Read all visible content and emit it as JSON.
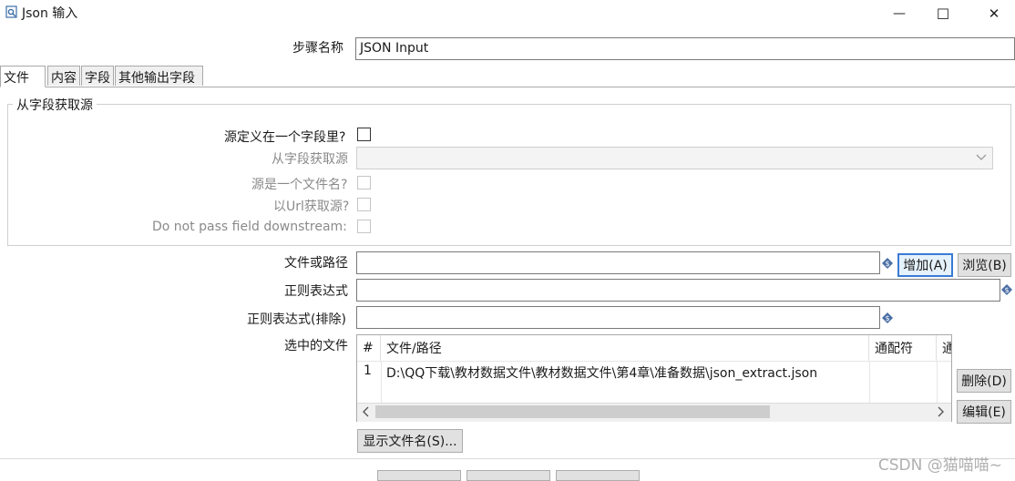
{
  "window": {
    "title": "Json 输入",
    "minimize_glyph": "—",
    "maximize_glyph": "☐",
    "close_glyph": "✕"
  },
  "step_name": {
    "label": "步骤名称",
    "value": "JSON Input"
  },
  "tabs": [
    {
      "label": "文件",
      "active": true
    },
    {
      "label": "内容",
      "active": false
    },
    {
      "label": "字段",
      "active": false
    },
    {
      "label": "其他输出字段",
      "active": false
    }
  ],
  "source_group": {
    "title": "从字段获取源",
    "source_in_field_label": "源定义在一个字段里?",
    "from_field_label": "从字段获取源",
    "from_field_value": "",
    "source_is_filename_label": "源是一个文件名?",
    "read_url_label": "以Url获取源?",
    "do_not_pass_label": "Do not pass field downstream:"
  },
  "file": {
    "path_label": "文件或路径",
    "path_value": "",
    "add_button": "增加(A)",
    "browse_button": "浏览(B)",
    "regex_label": "正则表达式",
    "regex_value": "",
    "regex_exclude_label": "正则表达式(排除)",
    "regex_exclude_value": ""
  },
  "selected_files": {
    "label": "选中的文件",
    "columns": [
      "#",
      "文件/路径",
      "通配符",
      "通"
    ],
    "rows": [
      {
        "num": "1",
        "path": "D:\\QQ下载\\教材数据文件\\教材数据文件\\第4章\\准备数据\\json_extract.json",
        "wildcard": ""
      }
    ],
    "delete_button": "删除(D)",
    "edit_button": "编辑(E)",
    "show_filenames_button": "显示文件名(S)..."
  },
  "watermark": "CSDN @猫喵喵~",
  "colors": {
    "default_button_border": "#3a7bd5",
    "variable_icon": "#4a6fa5"
  }
}
